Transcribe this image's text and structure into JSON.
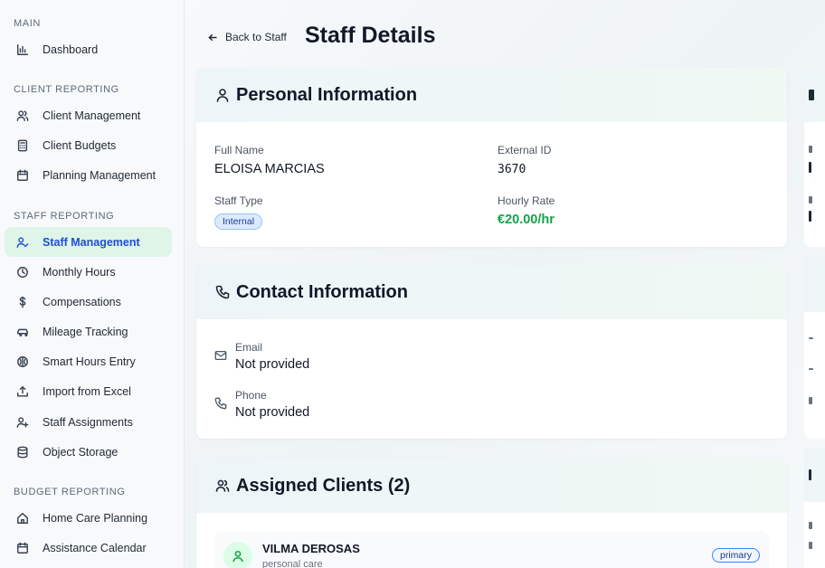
{
  "sidebar": {
    "sections": [
      {
        "title": "MAIN",
        "items": [
          {
            "label": "Dashboard",
            "icon": "bar-chart-icon"
          }
        ]
      },
      {
        "title": "CLIENT REPORTING",
        "items": [
          {
            "label": "Client Management",
            "icon": "users-icon"
          },
          {
            "label": "Client Budgets",
            "icon": "calculator-icon"
          },
          {
            "label": "Planning Management",
            "icon": "calendar-icon"
          }
        ]
      },
      {
        "title": "STAFF REPORTING",
        "items": [
          {
            "label": "Staff Management",
            "icon": "user-check-icon",
            "active": true
          },
          {
            "label": "Monthly Hours",
            "icon": "clock-icon"
          },
          {
            "label": "Compensations",
            "icon": "dollar-icon"
          },
          {
            "label": "Mileage Tracking",
            "icon": "car-icon"
          },
          {
            "label": "Smart Hours Entry",
            "icon": "brain-icon"
          },
          {
            "label": "Import from Excel",
            "icon": "upload-icon"
          },
          {
            "label": "Staff Assignments",
            "icon": "user-plus-icon"
          },
          {
            "label": "Object Storage",
            "icon": "database-icon"
          }
        ]
      },
      {
        "title": "BUDGET REPORTING",
        "items": [
          {
            "label": "Home Care Planning",
            "icon": "home-icon"
          },
          {
            "label": "Assistance Calendar",
            "icon": "calendar-icon"
          }
        ]
      }
    ]
  },
  "header": {
    "back_label": "Back to Staff",
    "title": "Staff Details"
  },
  "personal": {
    "title": "Personal Information",
    "full_name_label": "Full Name",
    "full_name": "ELOISA MARCIAS",
    "external_id_label": "External ID",
    "external_id": "3670",
    "staff_type_label": "Staff Type",
    "staff_type": "Internal",
    "hourly_rate_label": "Hourly Rate",
    "hourly_rate": "€20.00/hr"
  },
  "contact": {
    "title": "Contact Information",
    "email_label": "Email",
    "email": "Not provided",
    "phone_label": "Phone",
    "phone": "Not provided"
  },
  "clients": {
    "title": "Assigned Clients (2)",
    "items": [
      {
        "name": "VILMA DEROSAS",
        "type": "personal care",
        "badge": "primary"
      }
    ]
  },
  "colors": {
    "active_nav_bg": "#dff5e8",
    "active_nav_text": "#1d4ed8",
    "rate": "#16a34a",
    "badge_bg": "#dbeafe"
  }
}
